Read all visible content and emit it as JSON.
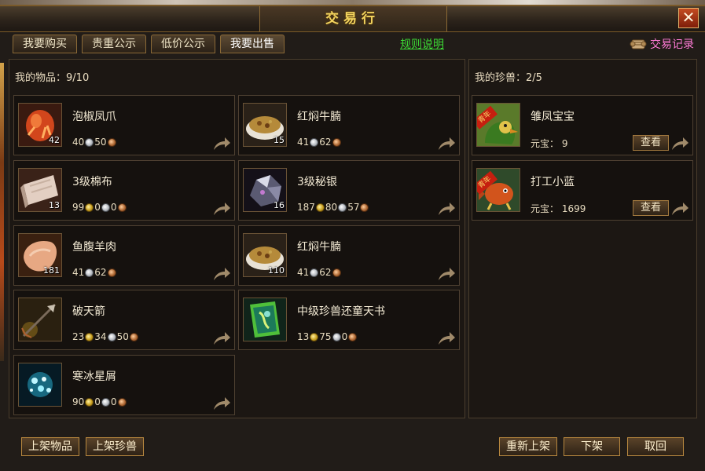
{
  "window": {
    "title": "交易行",
    "close_glyph": "✕"
  },
  "tabs": [
    {
      "label": "我要购买",
      "active": false
    },
    {
      "label": "贵重公示",
      "active": false
    },
    {
      "label": "低价公示",
      "active": false
    },
    {
      "label": "我要出售",
      "active": true
    }
  ],
  "rules_link": "规则说明",
  "history": {
    "label": "交易记录",
    "icon": "scroll-icon"
  },
  "items_panel": {
    "header_label": "我的物品：",
    "count": "9/10",
    "items": [
      {
        "name": "泡椒凤爪",
        "qty": "42",
        "icon": "chicken-feet-icon",
        "price": [
          {
            "amount": "40",
            "coin": "silver"
          },
          {
            "amount": "50",
            "coin": "copper"
          }
        ]
      },
      {
        "name": "红焖牛腩",
        "qty": "15",
        "icon": "braised-beef-icon",
        "price": [
          {
            "amount": "41",
            "coin": "silver"
          },
          {
            "amount": "62",
            "coin": "copper"
          }
        ]
      },
      {
        "name": "3级棉布",
        "qty": "13",
        "icon": "cotton-cloth-icon",
        "price": [
          {
            "amount": "99",
            "coin": "gold"
          },
          {
            "amount": "0",
            "coin": "silver"
          },
          {
            "amount": "0",
            "coin": "copper"
          }
        ]
      },
      {
        "name": "3级秘银",
        "qty": "16",
        "icon": "mithril-ore-icon",
        "price": [
          {
            "amount": "187",
            "coin": "gold"
          },
          {
            "amount": "80",
            "coin": "silver"
          },
          {
            "amount": "57",
            "coin": "copper"
          }
        ]
      },
      {
        "name": "鱼腹羊肉",
        "qty": "181",
        "icon": "mutton-icon",
        "price": [
          {
            "amount": "41",
            "coin": "silver"
          },
          {
            "amount": "62",
            "coin": "copper"
          }
        ]
      },
      {
        "name": "红焖牛腩",
        "qty": "110",
        "icon": "braised-beef-icon",
        "price": [
          {
            "amount": "41",
            "coin": "silver"
          },
          {
            "amount": "62",
            "coin": "copper"
          }
        ]
      },
      {
        "name": "破天箭",
        "qty": "",
        "icon": "arrow-icon",
        "price": [
          {
            "amount": "23",
            "coin": "gold"
          },
          {
            "amount": "34",
            "coin": "silver"
          },
          {
            "amount": "50",
            "coin": "copper"
          }
        ]
      },
      {
        "name": "中级珍兽还童天书",
        "qty": "",
        "icon": "skill-book-icon",
        "price": [
          {
            "amount": "13",
            "coin": "gold"
          },
          {
            "amount": "75",
            "coin": "silver"
          },
          {
            "amount": "0",
            "coin": "copper"
          }
        ]
      },
      {
        "name": "寒冰星屑",
        "qty": "",
        "icon": "ice-crystal-icon",
        "price": [
          {
            "amount": "90",
            "coin": "gold"
          },
          {
            "amount": "0",
            "coin": "silver"
          },
          {
            "amount": "0",
            "coin": "copper"
          }
        ]
      }
    ]
  },
  "pets_panel": {
    "header_label": "我的珍兽：",
    "count": "2/5",
    "pets": [
      {
        "name": "雏凤宝宝",
        "price_label": "元宝：",
        "price": "9",
        "view_label": "查看",
        "badge": "青年",
        "icon": "phoenix-chick-icon"
      },
      {
        "name": "打工小蓝",
        "price_label": "元宝：",
        "price": "1699",
        "view_label": "查看",
        "badge": "青年",
        "icon": "blue-fish-icon"
      }
    ]
  },
  "bottom_buttons": {
    "list_item": "上架物品",
    "list_pet": "上架珍兽",
    "relist": "重新上架",
    "delist": "下架",
    "cancel": "取回"
  },
  "colors": {
    "title": "#f2d35e",
    "link": "#3ddb35",
    "history": "#ff7bd6",
    "frame_border": "#8b6a37"
  }
}
